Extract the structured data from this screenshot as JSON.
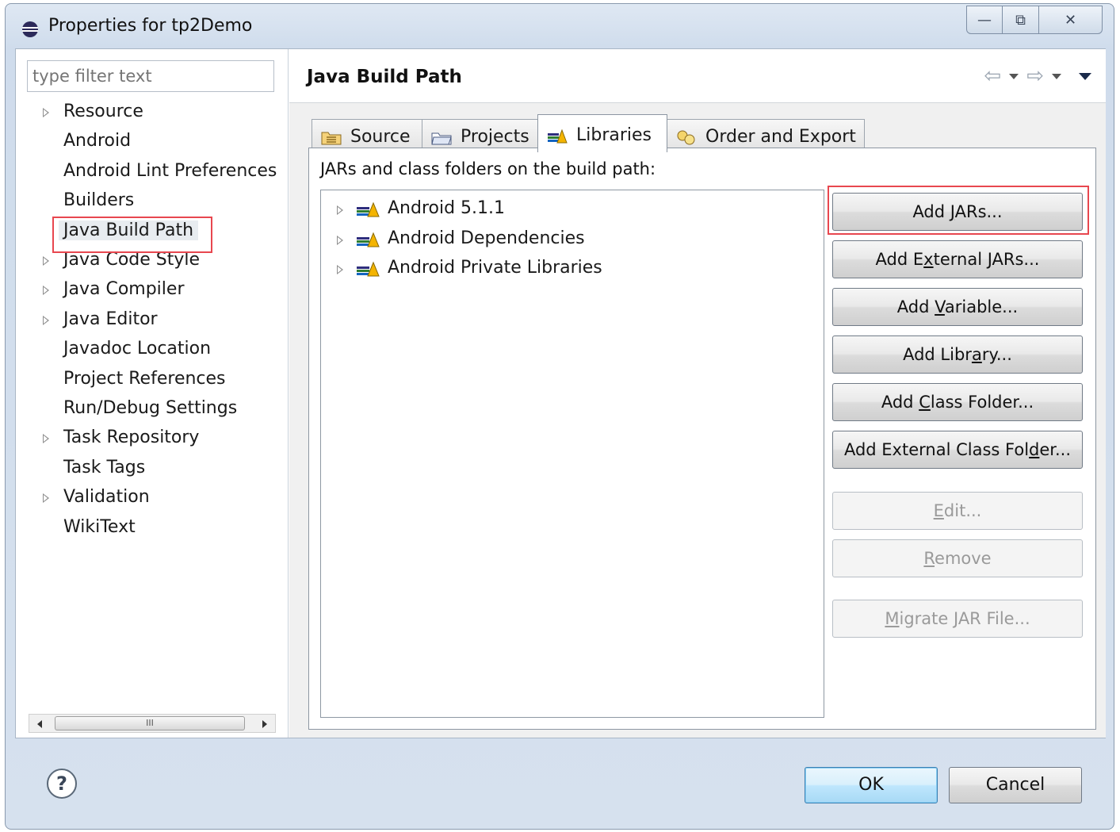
{
  "window": {
    "title": "Properties for tp2Demo",
    "controls": {
      "minimize": "—",
      "restore": "⧉",
      "close": "✕"
    }
  },
  "filter": {
    "placeholder": "type filter text"
  },
  "categories": [
    {
      "label": "Resource",
      "expandable": true
    },
    {
      "label": "Android",
      "expandable": false
    },
    {
      "label": "Android Lint Preferences",
      "expandable": false
    },
    {
      "label": "Builders",
      "expandable": false
    },
    {
      "label": "Java Build Path",
      "expandable": false,
      "selected": true
    },
    {
      "label": "Java Code Style",
      "expandable": true
    },
    {
      "label": "Java Compiler",
      "expandable": true
    },
    {
      "label": "Java Editor",
      "expandable": true
    },
    {
      "label": "Javadoc Location",
      "expandable": false
    },
    {
      "label": "Project References",
      "expandable": false
    },
    {
      "label": "Run/Debug Settings",
      "expandable": false
    },
    {
      "label": "Task Repository",
      "expandable": true
    },
    {
      "label": "Task Tags",
      "expandable": false
    },
    {
      "label": "Validation",
      "expandable": true
    },
    {
      "label": "WikiText",
      "expandable": false
    }
  ],
  "scrollbar": {
    "thumb_grip": "III"
  },
  "page": {
    "title": "Java Build Path"
  },
  "tabs": [
    {
      "label": "Source",
      "icon": "source-folder-icon"
    },
    {
      "label": "Projects",
      "icon": "projects-folder-icon"
    },
    {
      "label": "Libraries",
      "icon": "libraries-icon",
      "active": true
    },
    {
      "label": "Order and Export",
      "icon": "order-export-icon"
    }
  ],
  "libraries": {
    "label": "JARs and class folders on the build path:",
    "items": [
      "Android 5.1.1",
      "Android Dependencies",
      "Android Private Libraries"
    ]
  },
  "buttons": [
    {
      "pre": "Add ",
      "mn": "J",
      "post": "ARs...",
      "enabled": true
    },
    {
      "pre": "Add E",
      "mn": "x",
      "post": "ternal JARs...",
      "enabled": true
    },
    {
      "pre": "Add ",
      "mn": "V",
      "post": "ariable...",
      "enabled": true
    },
    {
      "pre": "Add Libr",
      "mn": "a",
      "post": "ry...",
      "enabled": true
    },
    {
      "pre": "Add ",
      "mn": "C",
      "post": "lass Folder...",
      "enabled": true
    },
    {
      "pre": "Add External Class Fol",
      "mn": "d",
      "post": "er...",
      "enabled": true
    },
    {
      "pre": "",
      "mn": "E",
      "post": "dit...",
      "enabled": false
    },
    {
      "pre": "",
      "mn": "R",
      "post": "emove",
      "enabled": false
    },
    {
      "pre": "",
      "mn": "M",
      "post": "igrate JAR File...",
      "enabled": false
    }
  ],
  "footer": {
    "help": "?",
    "ok": "OK",
    "cancel": "Cancel"
  },
  "colors": {
    "highlight": "#e8474f",
    "default_button": "#a7d9f5"
  }
}
